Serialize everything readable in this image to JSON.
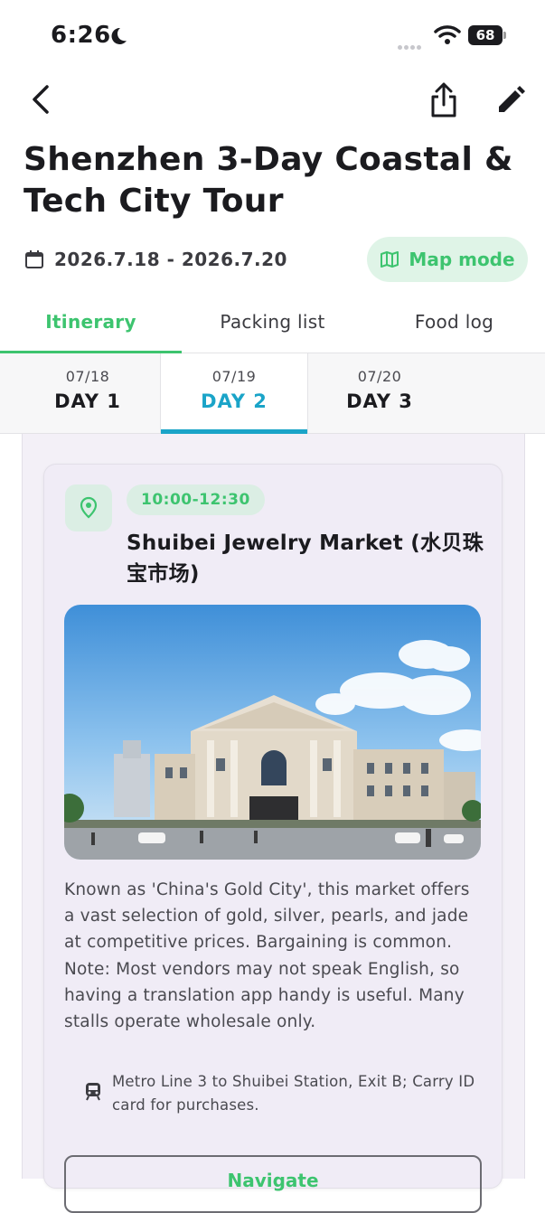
{
  "status_bar": {
    "time": "6:26",
    "battery": "68"
  },
  "header": {
    "title": "Shenzhen 3-Day Coastal & Tech City Tour"
  },
  "trip": {
    "dates": "2026.7.18 - 2026.7.20",
    "map_button": "Map mode"
  },
  "tabs": [
    {
      "label": "Itinerary",
      "active": true
    },
    {
      "label": "Packing list",
      "active": false
    },
    {
      "label": "Food log",
      "active": false
    }
  ],
  "days": [
    {
      "date": "07/18",
      "label": "DAY 1",
      "active": false
    },
    {
      "date": "07/19",
      "label": "DAY 2",
      "active": true
    },
    {
      "date": "07/20",
      "label": "DAY 3",
      "active": false
    }
  ],
  "activity": {
    "time": "10:00-12:30",
    "name": "Shuibei Jewelry Market (水贝珠宝市场)",
    "description": "Known as 'China's Gold City', this market offers a vast selection of gold, silver, pearls, and jade at competitive prices. Bargaining is common. Note: Most vendors may not speak English, so having a translation app handy is useful. Many stalls operate wholesale only.",
    "transit_icon": "train-icon",
    "transit": "Metro Line 3 to Shuibei Station, Exit B; Carry ID card for purchases.",
    "navigate_button": "Navigate"
  },
  "colors": {
    "accent_green": "#3dc46f",
    "accent_blue": "#1aa4c8",
    "card_bg": "#f0ecf6"
  }
}
